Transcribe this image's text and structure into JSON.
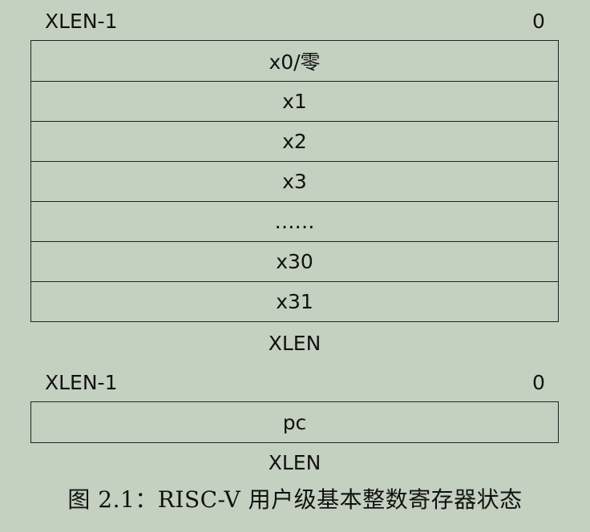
{
  "gpr_section": {
    "msb_label": "XLEN-1",
    "lsb_label": "0",
    "registers": [
      "x0/零",
      "x1",
      "x2",
      "x3",
      "……",
      "x30",
      "x31"
    ],
    "width_label": "XLEN"
  },
  "pc_section": {
    "msb_label": "XLEN-1",
    "lsb_label": "0",
    "register": "pc",
    "width_label": "XLEN"
  },
  "caption": "图 2.1：RISC-V 用户级基本整数寄存器状态"
}
